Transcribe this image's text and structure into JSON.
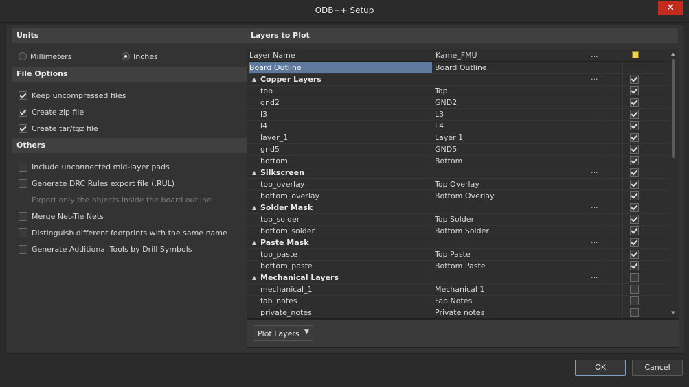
{
  "window": {
    "title": "ODB++ Setup",
    "close_glyph": "✕"
  },
  "left": {
    "units": {
      "header": "Units",
      "options": [
        {
          "label": "Millimeters",
          "checked": false
        },
        {
          "label": "Inches",
          "checked": true
        }
      ]
    },
    "file_options": {
      "header": "File Options",
      "items": [
        {
          "label": "Keep uncompressed files",
          "checked": true
        },
        {
          "label": "Create zip file",
          "checked": true
        },
        {
          "label": "Create tar/tgz file",
          "checked": true
        }
      ]
    },
    "others": {
      "header": "Others",
      "items": [
        {
          "label": "Include unconnected mid-layer pads",
          "checked": false,
          "disabled": false
        },
        {
          "label": "Generate DRC Rules export file (.RUL)",
          "checked": false,
          "disabled": false
        },
        {
          "label": "Export only the objects inside the board outline",
          "checked": false,
          "disabled": true
        },
        {
          "label": "Merge Net-Tie Nets",
          "checked": false,
          "disabled": false
        },
        {
          "label": "Distinguish different footprints with the same name",
          "checked": false,
          "disabled": false
        },
        {
          "label": "Generate Additional Tools by Drill Symbols",
          "checked": false,
          "disabled": false
        }
      ]
    }
  },
  "right": {
    "header": "Layers to Plot",
    "grid": {
      "col_layer_name": "Layer Name",
      "col_mapping": "Kame_FMU",
      "col_dots": "...",
      "rows": [
        {
          "type": "selected",
          "name": "Board Outline",
          "mapped": "Board Outline",
          "checked": null
        },
        {
          "type": "group",
          "name": "Copper Layers",
          "mapped": "",
          "checked": true
        },
        {
          "type": "layer",
          "name": "top",
          "mapped": "Top",
          "checked": true
        },
        {
          "type": "layer",
          "name": "gnd2",
          "mapped": "GND2",
          "checked": true
        },
        {
          "type": "layer",
          "name": "l3",
          "mapped": "L3",
          "checked": true
        },
        {
          "type": "layer",
          "name": "l4",
          "mapped": "L4",
          "checked": true
        },
        {
          "type": "layer",
          "name": "layer_1",
          "mapped": "Layer 1",
          "checked": true
        },
        {
          "type": "layer",
          "name": "gnd5",
          "mapped": "GND5",
          "checked": true
        },
        {
          "type": "layer",
          "name": "bottom",
          "mapped": "Bottom",
          "checked": true
        },
        {
          "type": "group",
          "name": "Silkscreen",
          "mapped": "",
          "checked": true
        },
        {
          "type": "layer",
          "name": "top_overlay",
          "mapped": "Top Overlay",
          "checked": true
        },
        {
          "type": "layer",
          "name": "bottom_overlay",
          "mapped": "Bottom Overlay",
          "checked": true
        },
        {
          "type": "group",
          "name": "Solder Mask",
          "mapped": "",
          "checked": true
        },
        {
          "type": "layer",
          "name": "top_solder",
          "mapped": "Top Solder",
          "checked": true
        },
        {
          "type": "layer",
          "name": "bottom_solder",
          "mapped": "Bottom Solder",
          "checked": true
        },
        {
          "type": "group",
          "name": "Paste Mask",
          "mapped": "",
          "checked": true
        },
        {
          "type": "layer",
          "name": "top_paste",
          "mapped": "Top Paste",
          "checked": true
        },
        {
          "type": "layer",
          "name": "bottom_paste",
          "mapped": "Bottom Paste",
          "checked": true
        },
        {
          "type": "group",
          "name": "Mechanical Layers",
          "mapped": "",
          "checked": false
        },
        {
          "type": "layer",
          "name": "mechanical_1",
          "mapped": "Mechanical 1",
          "checked": false
        },
        {
          "type": "layer",
          "name": "fab_notes",
          "mapped": "Fab Notes",
          "checked": false
        },
        {
          "type": "layer",
          "name": "private_notes",
          "mapped": "Private notes",
          "checked": false
        }
      ]
    },
    "plot_button": {
      "label": "Plot Layers"
    }
  },
  "buttons": {
    "ok": "OK",
    "cancel": "Cancel"
  }
}
